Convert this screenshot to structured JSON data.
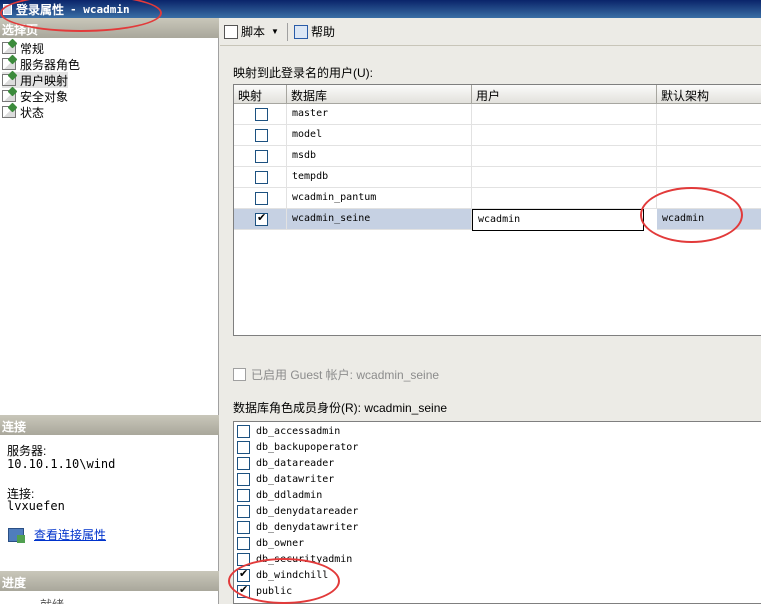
{
  "window": {
    "title": "登录属性",
    "title_suffix": "- wcadmin"
  },
  "left_pane": {
    "select_page_header": "选择页",
    "nav_items": [
      "常规",
      "服务器角色",
      "用户映射",
      "安全对象",
      "状态"
    ],
    "selected_nav": "用户映射",
    "connection_header": "连接",
    "server_label": "服务器:",
    "server_value": "10.10.1.10\\wind",
    "connection_label": "连接:",
    "connection_value": "lvxuefen",
    "view_connection_link": "查看连接属性",
    "progress_header": "进度",
    "progress_status": "就绪"
  },
  "toolbar": {
    "script_label": "脚本",
    "help_label": "帮助"
  },
  "mapping": {
    "section_label": "映射到此登录名的用户(U):",
    "columns": [
      "映射",
      "数据库",
      "用户",
      "默认架构"
    ],
    "rows": [
      {
        "checked": false,
        "database": "master",
        "user": "",
        "schema": ""
      },
      {
        "checked": false,
        "database": "model",
        "user": "",
        "schema": ""
      },
      {
        "checked": false,
        "database": "msdb",
        "user": "",
        "schema": ""
      },
      {
        "checked": false,
        "database": "tempdb",
        "user": "",
        "schema": ""
      },
      {
        "checked": false,
        "database": "wcadmin_pantum",
        "user": "",
        "schema": ""
      },
      {
        "checked": true,
        "database": "wcadmin_seine",
        "user": "wcadmin",
        "schema": "wcadmin"
      }
    ]
  },
  "guest": {
    "label": "已启用 Guest 帐户: wcadmin_seine",
    "enabled": false
  },
  "roles": {
    "section_label": "数据库角色成员身份(R): wcadmin_seine",
    "items": [
      {
        "name": "db_accessadmin",
        "checked": false
      },
      {
        "name": "db_backupoperator",
        "checked": false
      },
      {
        "name": "db_datareader",
        "checked": false
      },
      {
        "name": "db_datawriter",
        "checked": false
      },
      {
        "name": "db_ddladmin",
        "checked": false
      },
      {
        "name": "db_denydatareader",
        "checked": false
      },
      {
        "name": "db_denydatawriter",
        "checked": false
      },
      {
        "name": "db_owner",
        "checked": false
      },
      {
        "name": "db_securityadmin",
        "checked": false
      },
      {
        "name": "db_windchill",
        "checked": true
      },
      {
        "name": "public",
        "checked": true
      }
    ]
  },
  "colors": {
    "annotation": "#e23a3a",
    "selected_row": "#c6d1e3",
    "title_bar": "#0a246a"
  }
}
